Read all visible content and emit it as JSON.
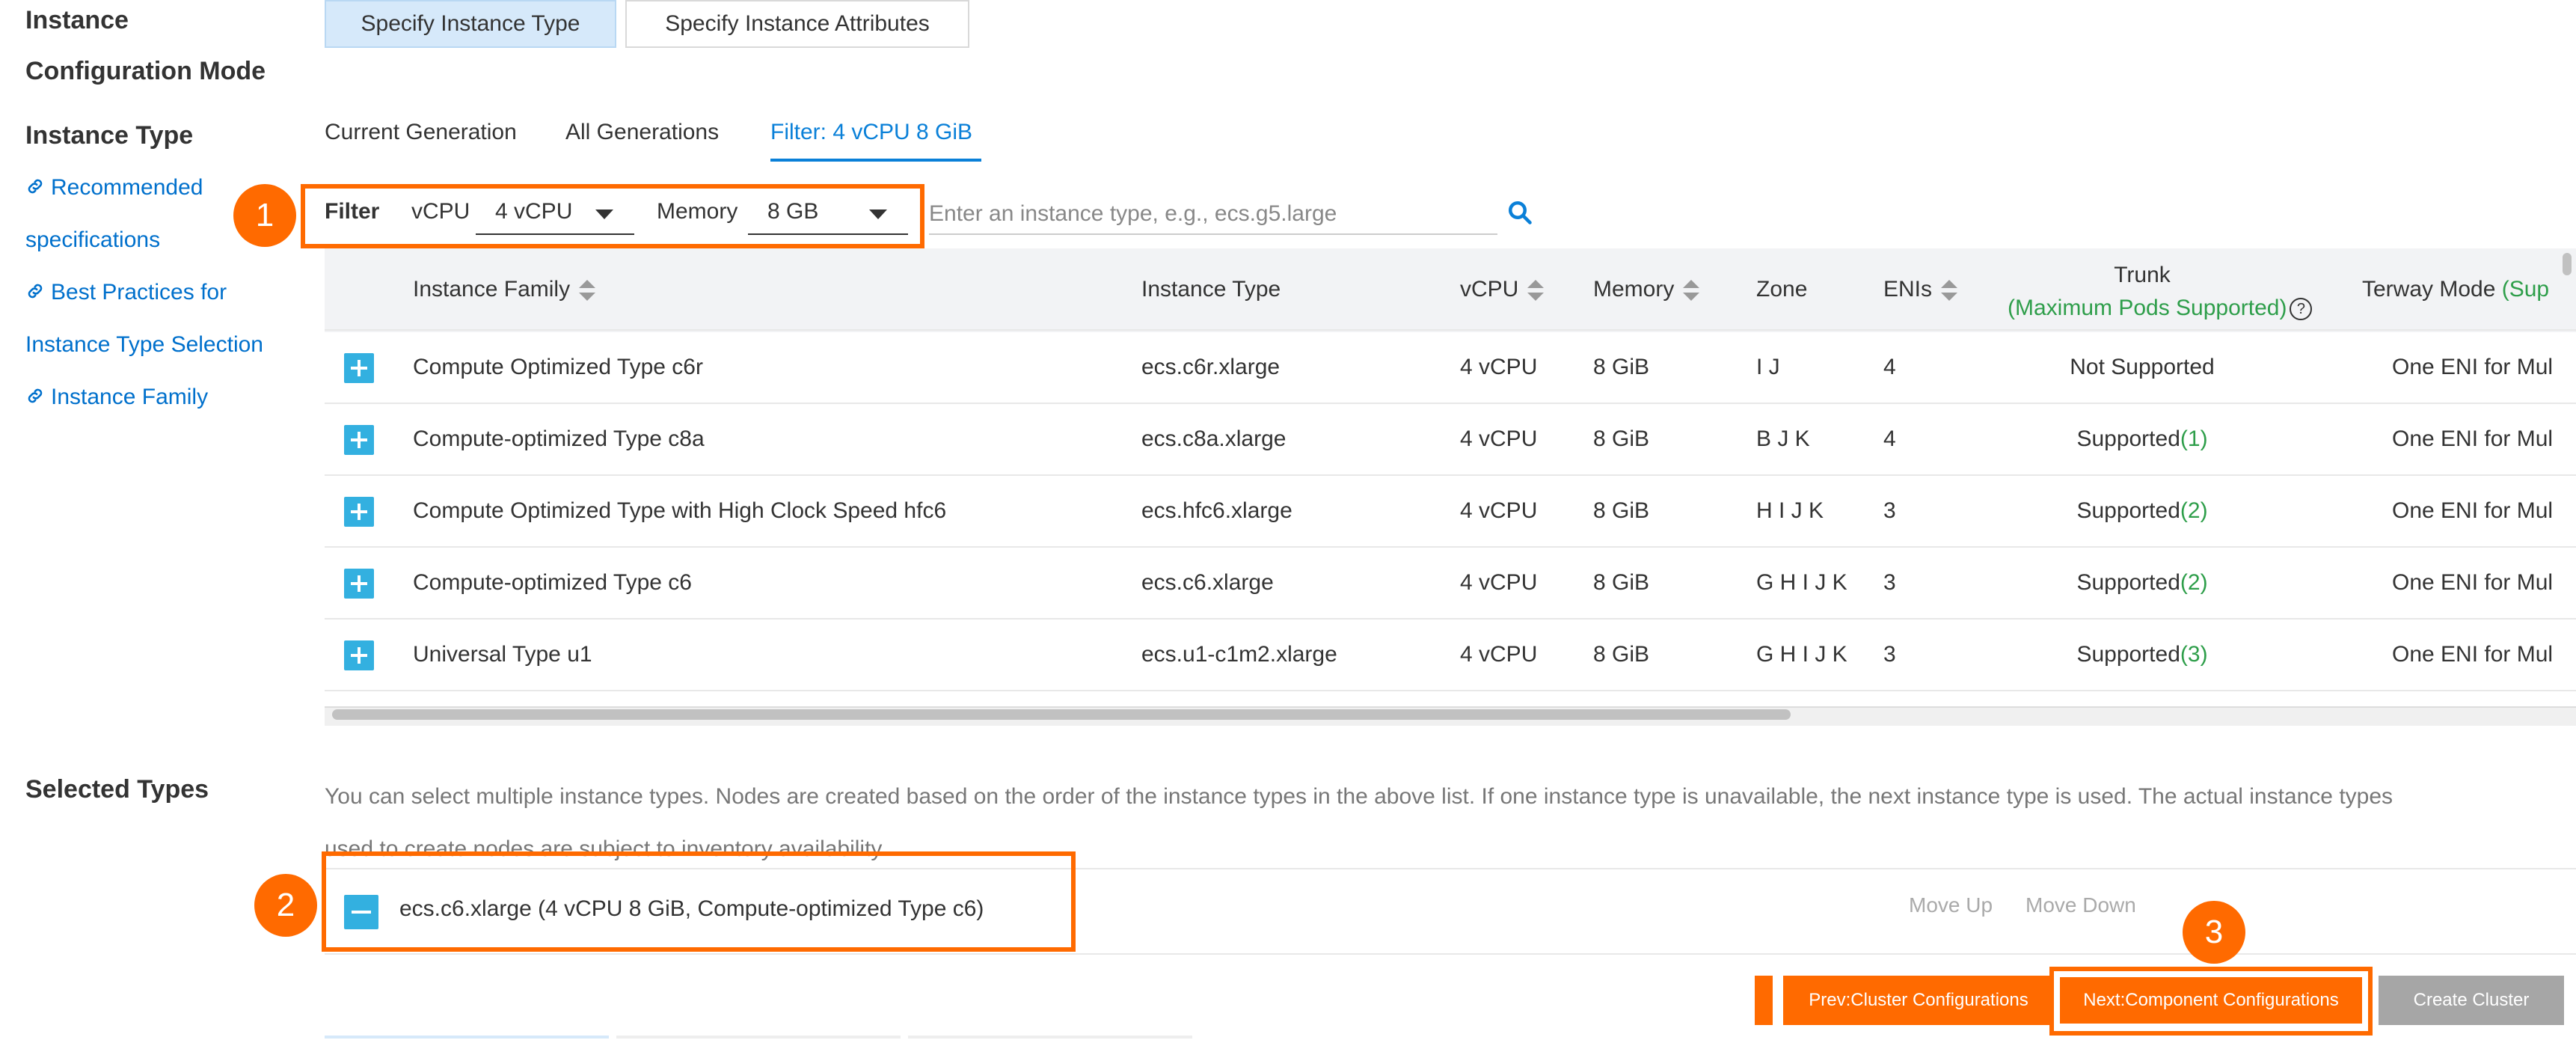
{
  "labels": {
    "config_mode_line1": "Instance",
    "config_mode_line2": "Configuration Mode",
    "instance_type": "Instance Type",
    "selected_types": "Selected Types"
  },
  "mode_buttons": [
    "Specify Instance Type",
    "Specify Instance Attributes"
  ],
  "side_links": [
    "Recommended",
    "specifications",
    "Best Practices for",
    "Instance Type Selection",
    "Instance Family"
  ],
  "tabs": [
    "Current Generation",
    "All Generations",
    "Filter: 4 vCPU 8 GiB"
  ],
  "filter": {
    "label": "Filter",
    "vcpu_label": "vCPU",
    "vcpu_value": "4 vCPU",
    "memory_label": "Memory",
    "memory_value": "8 GB",
    "search_placeholder": "Enter an instance type, e.g., ecs.g5.large"
  },
  "table": {
    "headers": {
      "family": "Instance Family",
      "type": "Instance Type",
      "vcpu": "vCPU",
      "memory": "Memory",
      "zone": "Zone",
      "enis": "ENIs",
      "trunk": "Trunk",
      "trunk_sub": "(Maximum Pods Supported)",
      "terway": "Terway Mode",
      "terway_sub": "(Sup"
    },
    "rows": [
      {
        "family": "Compute Optimized Type c6r",
        "type": "ecs.c6r.xlarge",
        "vcpu": "4 vCPU",
        "memory": "8 GiB",
        "zone": "I J",
        "enis": "4",
        "trunk": "Not Supported",
        "pods": "",
        "terway": "One ENI for Mul"
      },
      {
        "family": "Compute-optimized Type c8a",
        "type": "ecs.c8a.xlarge",
        "vcpu": "4 vCPU",
        "memory": "8 GiB",
        "zone": "B J K",
        "enis": "4",
        "trunk": "Supported",
        "pods": "(1)",
        "terway": "One ENI for Mul"
      },
      {
        "family": "Compute Optimized Type with High Clock Speed hfc6",
        "type": "ecs.hfc6.xlarge",
        "vcpu": "4 vCPU",
        "memory": "8 GiB",
        "zone": "H I J K",
        "enis": "3",
        "trunk": "Supported",
        "pods": "(2)",
        "terway": "One ENI for Mul"
      },
      {
        "family": "Compute-optimized Type c6",
        "type": "ecs.c6.xlarge",
        "vcpu": "4 vCPU",
        "memory": "8 GiB",
        "zone": "G H I J K",
        "enis": "3",
        "trunk": "Supported",
        "pods": "(2)",
        "terway": "One ENI for Mul"
      },
      {
        "family": "Universal Type u1",
        "type": "ecs.u1-c1m2.xlarge",
        "vcpu": "4 vCPU",
        "memory": "8 GiB",
        "zone": "G H I J K",
        "enis": "3",
        "trunk": "Supported",
        "pods": "(3)",
        "terway": "One ENI for Mul"
      }
    ]
  },
  "selected": {
    "note_line1": "You can select multiple instance types. Nodes are created based on the order of the instance types in the above list. If one instance type is unavailable, the next instance type is used. The actual instance types",
    "note_line2": "used to create nodes are subject to inventory availability.",
    "item": "ecs.c6.xlarge (4 vCPU 8 GiB, Compute-optimized Type c6)",
    "move_up": "Move Up",
    "move_down": "Move Down"
  },
  "steps": [
    "1",
    "2",
    "3"
  ],
  "footer": {
    "prev": "Prev:Cluster Configurations",
    "next": "Next:Component Configurations",
    "create": "Create Cluster"
  },
  "colors": {
    "accent_orange": "#ff6a00",
    "link_blue": "#0070cc",
    "tab_blue": "#0a80d8",
    "green": "#2e9e4a",
    "plus_blue": "#33b0e0"
  }
}
